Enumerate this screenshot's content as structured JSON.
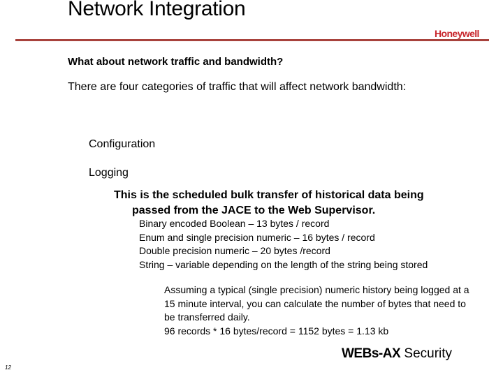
{
  "header": {
    "title": "Network Integration",
    "logo_text": "Honeywell",
    "rule_color": "#a8423c",
    "brand_color": "#c8262c"
  },
  "body": {
    "question": "What about network traffic and bandwidth?",
    "intro": "There are four categories of traffic that will affect network bandwidth:",
    "categories": [
      {
        "label": "Configuration"
      },
      {
        "label": "Logging"
      }
    ],
    "logging_description": {
      "line1": "This is the scheduled bulk transfer of historical data being",
      "line2": "passed from the JACE to the Web Supervisor."
    },
    "record_sizes": [
      "Binary encoded Boolean – 13 bytes / record",
      "Enum and single precision numeric – 16 bytes / record",
      "Double precision numeric – 20 bytes /record",
      "String – variable depending on the length of the string being stored"
    ],
    "calculation": [
      "Assuming a typical (single precision) numeric history being logged at a 15 minute interval, you can calculate the number of bytes that need to be transferred daily.",
      "96 records * 16 bytes/record = 1152 bytes = 1.13 kb"
    ]
  },
  "footer": {
    "brand_bold": "WEBs-AX",
    "brand_rest": " Security",
    "page_number": "12"
  }
}
